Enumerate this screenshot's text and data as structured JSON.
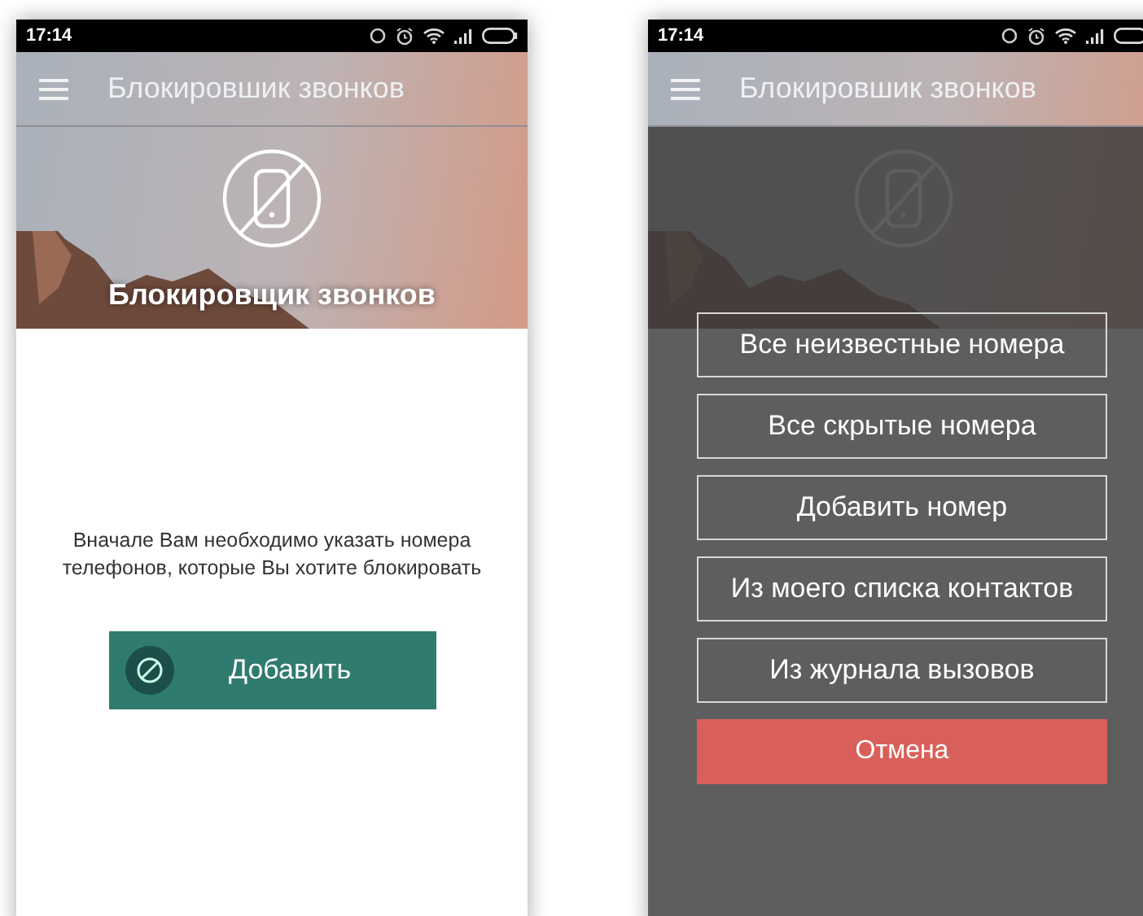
{
  "screens": [
    {
      "status_bar": {
        "time": "17:14"
      },
      "app_bar": {
        "title": "Блокировшик звонков"
      },
      "hero": {
        "title": "Блокировщик звонков"
      },
      "message": "Вначале Вам необходимо указать номера\nтелефонов, которые Вы хотите блокировать",
      "add_button": {
        "label": "Добавить"
      }
    },
    {
      "status_bar": {
        "time": "17:14"
      },
      "app_bar": {
        "title": "Блокировшик звонков"
      },
      "dialog": {
        "options": [
          "Все неизвестные номера",
          "Все скрытые номера",
          "Добавить номер",
          "Из моего списка контактов",
          "Из журнала вызовов"
        ],
        "cancel": "Отмена"
      }
    }
  ]
}
